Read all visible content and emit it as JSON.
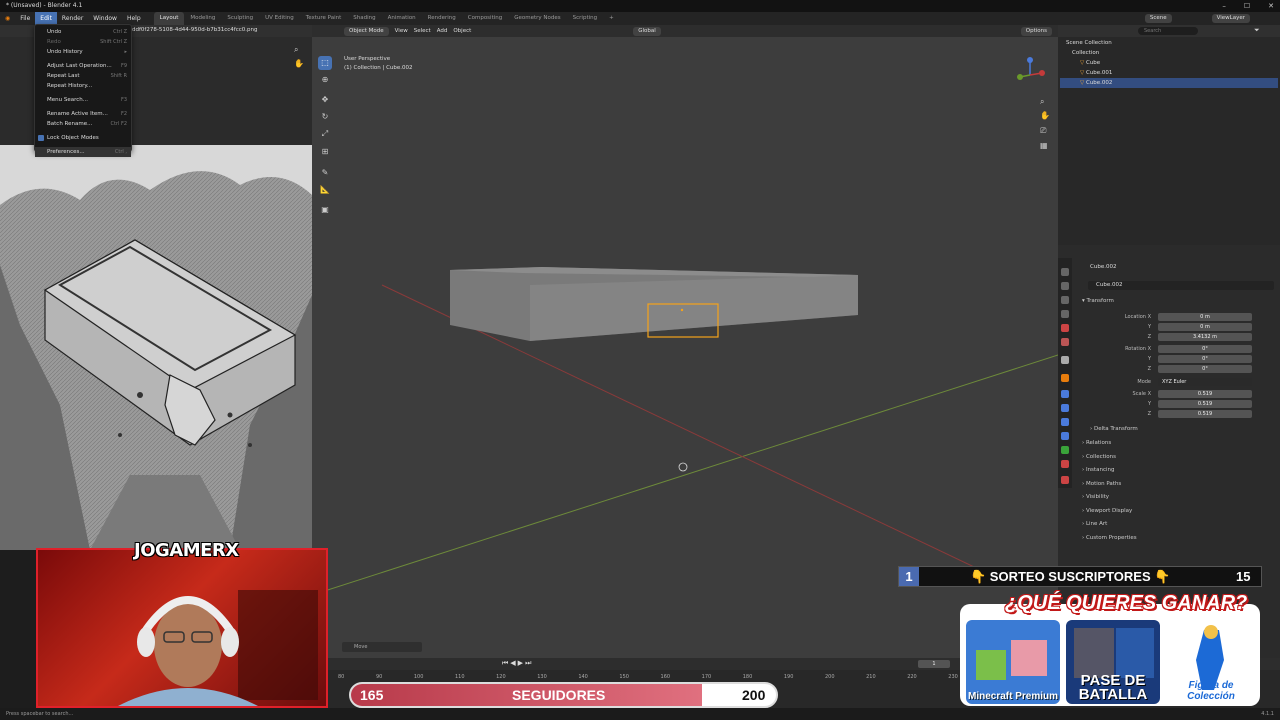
{
  "window": {
    "title": "* (Unsaved) - Blender 4.1"
  },
  "topbar": {
    "menus": [
      "File",
      "Edit",
      "Render",
      "Window",
      "Help"
    ],
    "workspaces": [
      "Layout",
      "Modeling",
      "Sculpting",
      "UV Editing",
      "Texture Paint",
      "Shading",
      "Animation",
      "Rendering",
      "Compositing",
      "Geometry Nodes",
      "Scripting"
    ],
    "scene": "Scene",
    "view_layer": "ViewLayer"
  },
  "image_editor": {
    "filename": "ddf0f278-5108-4d44-950d-b7b31cc4fcc0.png"
  },
  "edit_menu": {
    "items": [
      {
        "label": "Undo",
        "shortcut": "Ctrl Z",
        "disabled": false
      },
      {
        "label": "Redo",
        "shortcut": "Shift Ctrl Z",
        "disabled": true
      },
      {
        "label": "Undo History",
        "shortcut": "",
        "disabled": false
      },
      {
        "label": "Adjust Last Operation...",
        "shortcut": "F9",
        "disabled": false
      },
      {
        "label": "Repeat Last",
        "shortcut": "Shift R",
        "disabled": false
      },
      {
        "label": "Repeat History...",
        "shortcut": "",
        "disabled": false
      },
      {
        "label": "Menu Search...",
        "shortcut": "F3",
        "disabled": false
      },
      {
        "label": "Rename Active Item...",
        "shortcut": "F2",
        "disabled": false
      },
      {
        "label": "Batch Rename...",
        "shortcut": "Ctrl F2",
        "disabled": false
      },
      {
        "label": "Lock Object Modes",
        "shortcut": "",
        "disabled": false
      },
      {
        "label": "Preferences...",
        "shortcut": "Ctrl ,",
        "disabled": false
      }
    ]
  },
  "viewport": {
    "mode": "Object Mode",
    "menus": [
      "View",
      "Select",
      "Add",
      "Object"
    ],
    "orientation": "Global",
    "options": "Options",
    "perspective_label": "User Perspective",
    "collection_label": "(1) Collection | Cube.002",
    "last_op": "Move"
  },
  "outliner": {
    "search_placeholder": "Search",
    "items": [
      {
        "label": "Scene Collection",
        "selected": false
      },
      {
        "label": "Collection",
        "selected": false
      },
      {
        "label": "Cube",
        "selected": false
      },
      {
        "label": "Cube.001",
        "selected": false
      },
      {
        "label": "Cube.002",
        "selected": true
      }
    ]
  },
  "properties": {
    "object_name": "Cube.002",
    "object_field": "Cube.002",
    "transform_label": "Transform",
    "location": {
      "label": "Location X",
      "x": "0 m",
      "y": "0 m",
      "z": "3.4132 m"
    },
    "rotation": {
      "label": "Rotation X",
      "x": "0°",
      "y": "0°",
      "z": "0°"
    },
    "mode": {
      "label": "Mode",
      "value": "XYZ Euler"
    },
    "scale": {
      "label": "Scale X",
      "x": "0.519",
      "y": "0.519",
      "z": "0.519"
    },
    "axis_y": "Y",
    "axis_z": "Z",
    "sections": [
      "Delta Transform",
      "Relations",
      "Collections",
      "Instancing",
      "Motion Paths",
      "Visibility",
      "Viewport Display",
      "Line Art",
      "Custom Properties"
    ]
  },
  "timeline": {
    "ticks": [
      "80",
      "90",
      "100",
      "110",
      "120",
      "130",
      "140",
      "150",
      "160",
      "170",
      "180",
      "190",
      "200",
      "210",
      "220",
      "230"
    ],
    "current_frame": "1"
  },
  "statusbar": {
    "text": "Press spacebar to search...",
    "version": "4.1.1"
  },
  "overlay": {
    "channel": "JOGAMERX",
    "followers": {
      "current": "165",
      "label": "SEGUIDORES",
      "goal": "200",
      "progress": 0.825
    },
    "raffle": {
      "number": "1",
      "text": "👇 SORTEO SUSCRIPTORES 👇",
      "count": "15"
    },
    "prize_title": "¿QUÉ QUIERES GANAR?",
    "prizes": [
      {
        "label": "Minecraft Premium",
        "color": "#3b7bd4"
      },
      {
        "label": "PASE DE BATALLA",
        "color": "#1a3a7a"
      },
      {
        "label": "Figura de Colección",
        "color": "#1c6ad6"
      }
    ]
  },
  "colors": {
    "accent": "#4772b3",
    "selection_outline": "#f5a31a",
    "overlay_red": "#e0202a"
  }
}
